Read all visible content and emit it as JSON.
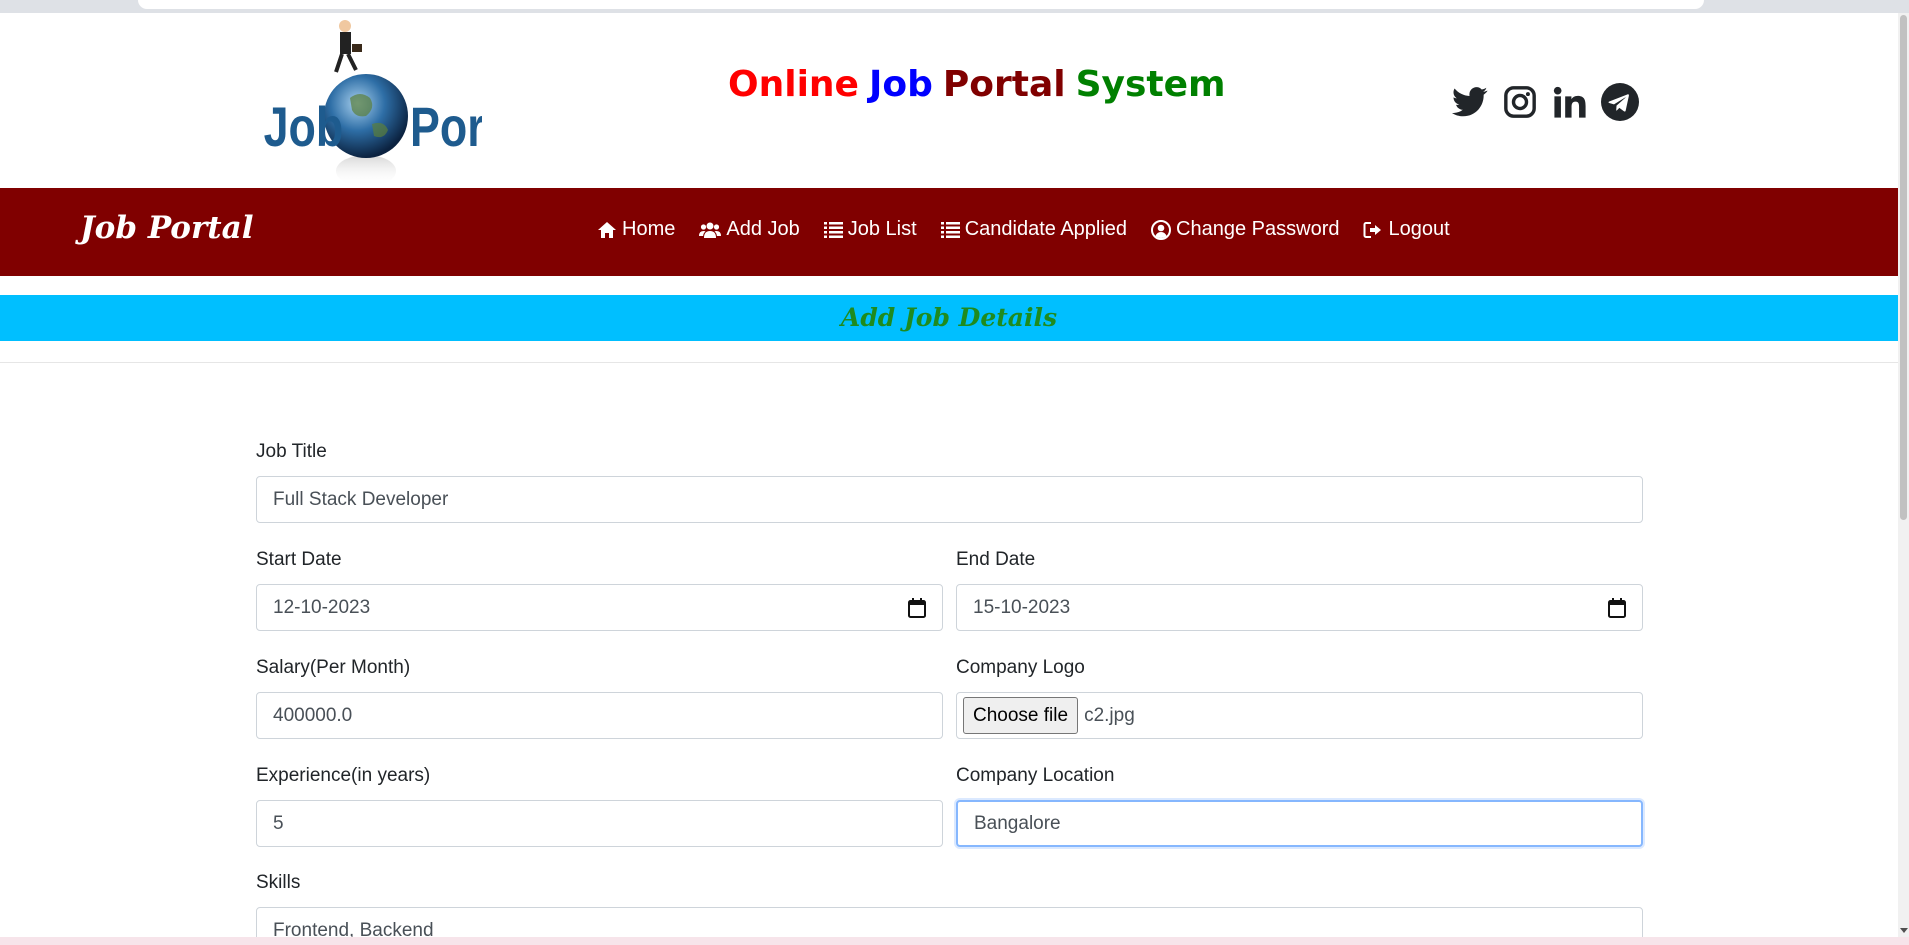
{
  "header": {
    "logo_text": "Job Portal",
    "title_words": [
      {
        "text": "Online",
        "color": "#ff0000"
      },
      {
        "text": "Job",
        "color": "#0000ff"
      },
      {
        "text": "Portal",
        "color": "#800000"
      },
      {
        "text": "System",
        "color": "#008000"
      }
    ],
    "social_icons": [
      "twitter-icon",
      "instagram-icon",
      "linkedin-icon",
      "telegram-icon"
    ]
  },
  "navbar": {
    "brand": "Job Portal",
    "bg_color": "#800000",
    "items": [
      {
        "label": "Home",
        "icon": "home-icon"
      },
      {
        "label": "Add Job",
        "icon": "users-icon"
      },
      {
        "label": "Job List",
        "icon": "list-icon"
      },
      {
        "label": "Candidate Applied",
        "icon": "list-icon"
      },
      {
        "label": "Change Password",
        "icon": "user-circle-icon"
      },
      {
        "label": "Logout",
        "icon": "sign-out-icon"
      }
    ]
  },
  "banner": {
    "title": "Add Job Details",
    "bg_color": "#00bfff"
  },
  "form": {
    "job_title": {
      "label": "Job Title",
      "value": "Full Stack Developer"
    },
    "start_date": {
      "label": "Start Date",
      "value": "12-10-2023"
    },
    "end_date": {
      "label": "End Date",
      "value": "15-10-2023"
    },
    "salary": {
      "label": "Salary(Per Month)",
      "value": "400000.0"
    },
    "company_logo": {
      "label": "Company Logo",
      "button": "Choose file",
      "file": "c2.jpg"
    },
    "experience": {
      "label": "Experience(in years)",
      "value": "5"
    },
    "company_location": {
      "label": "Company Location",
      "value": "Bangalore"
    },
    "skills": {
      "label": "Skills",
      "value": "Frontend, Backend"
    }
  }
}
